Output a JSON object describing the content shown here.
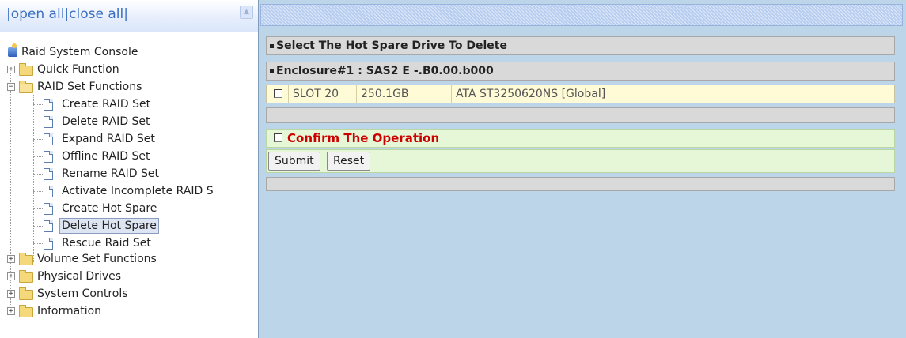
{
  "tree_header": {
    "open_all": "|open all",
    "close_all": "|close all|"
  },
  "tree": {
    "root": "Raid System Console",
    "quick_function": "Quick Function",
    "raid_set_functions": "RAID Set Functions",
    "raid_items": [
      "Create RAID Set",
      "Delete RAID Set",
      "Expand RAID Set",
      "Offline RAID Set",
      "Rename RAID Set",
      "Activate Incomplete RAID S",
      "Create Hot Spare",
      "Delete Hot Spare",
      "Rescue Raid Set"
    ],
    "selected_item": "Delete Hot Spare",
    "volume_set_functions": "Volume Set Functions",
    "physical_drives": "Physical Drives",
    "system_controls": "System Controls",
    "information": "Information"
  },
  "main": {
    "section_title": "Select The Hot Spare Drive To Delete",
    "enclosure_title": "Enclosure#1 : SAS2 E -.B0.00.b000",
    "hot_spare_rows": [
      {
        "slot": "SLOT 20",
        "capacity": "250.1GB",
        "model": "ATA ST3250620NS [Global]"
      }
    ],
    "confirm_label": "Confirm The Operation",
    "submit_label": "Submit",
    "reset_label": "Reset"
  },
  "colors": {
    "confirm_text": "#cc0000",
    "row_yellow": "#fffbd6",
    "row_green": "#e6f7d7",
    "frame_bg": "#bcd5e8",
    "link_blue": "#3a6fc4"
  }
}
